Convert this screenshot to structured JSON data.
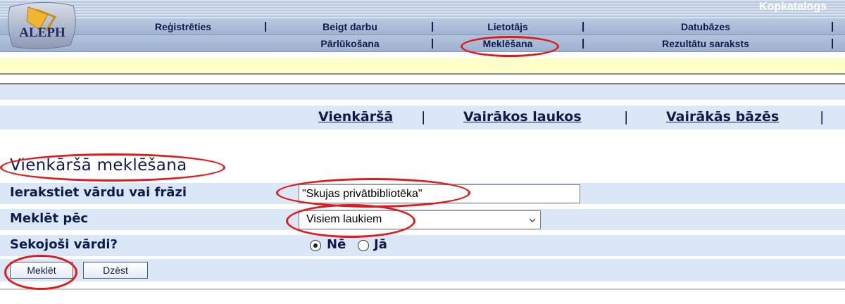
{
  "header": {
    "app_title": "Kopkatalogs",
    "logo_text": "ALEPH",
    "nav_row1": [
      "Reģistrēties",
      "Beigt darbu",
      "Lietotājs",
      "Datubāzes"
    ],
    "nav_row2": [
      "Pārlūkošana",
      "Meklēšana",
      "Rezultātu saraksts"
    ]
  },
  "subnav": [
    "Vienkāršā",
    "Vairākos laukos",
    "Vairākās bāzēs"
  ],
  "form": {
    "title": "Vienkāršā meklēšana",
    "term_label": "Ierakstiet vārdu vai frāzi",
    "term_value": "\"Skujas privātbibliotēka\"",
    "field_label": "Meklēt pēc",
    "field_value": "Visiem laukiem",
    "adjacent_label": "Sekojoši vārdi?",
    "adjacent_options": [
      "Nē",
      "Jā"
    ],
    "adjacent_selected": "Nē",
    "search_button": "Meklēt",
    "clear_button": "Dzēst"
  },
  "colors": {
    "annotation": "#e01b1b",
    "row_background": "#dbe7f6",
    "notice_bar": "#ffffc9"
  }
}
